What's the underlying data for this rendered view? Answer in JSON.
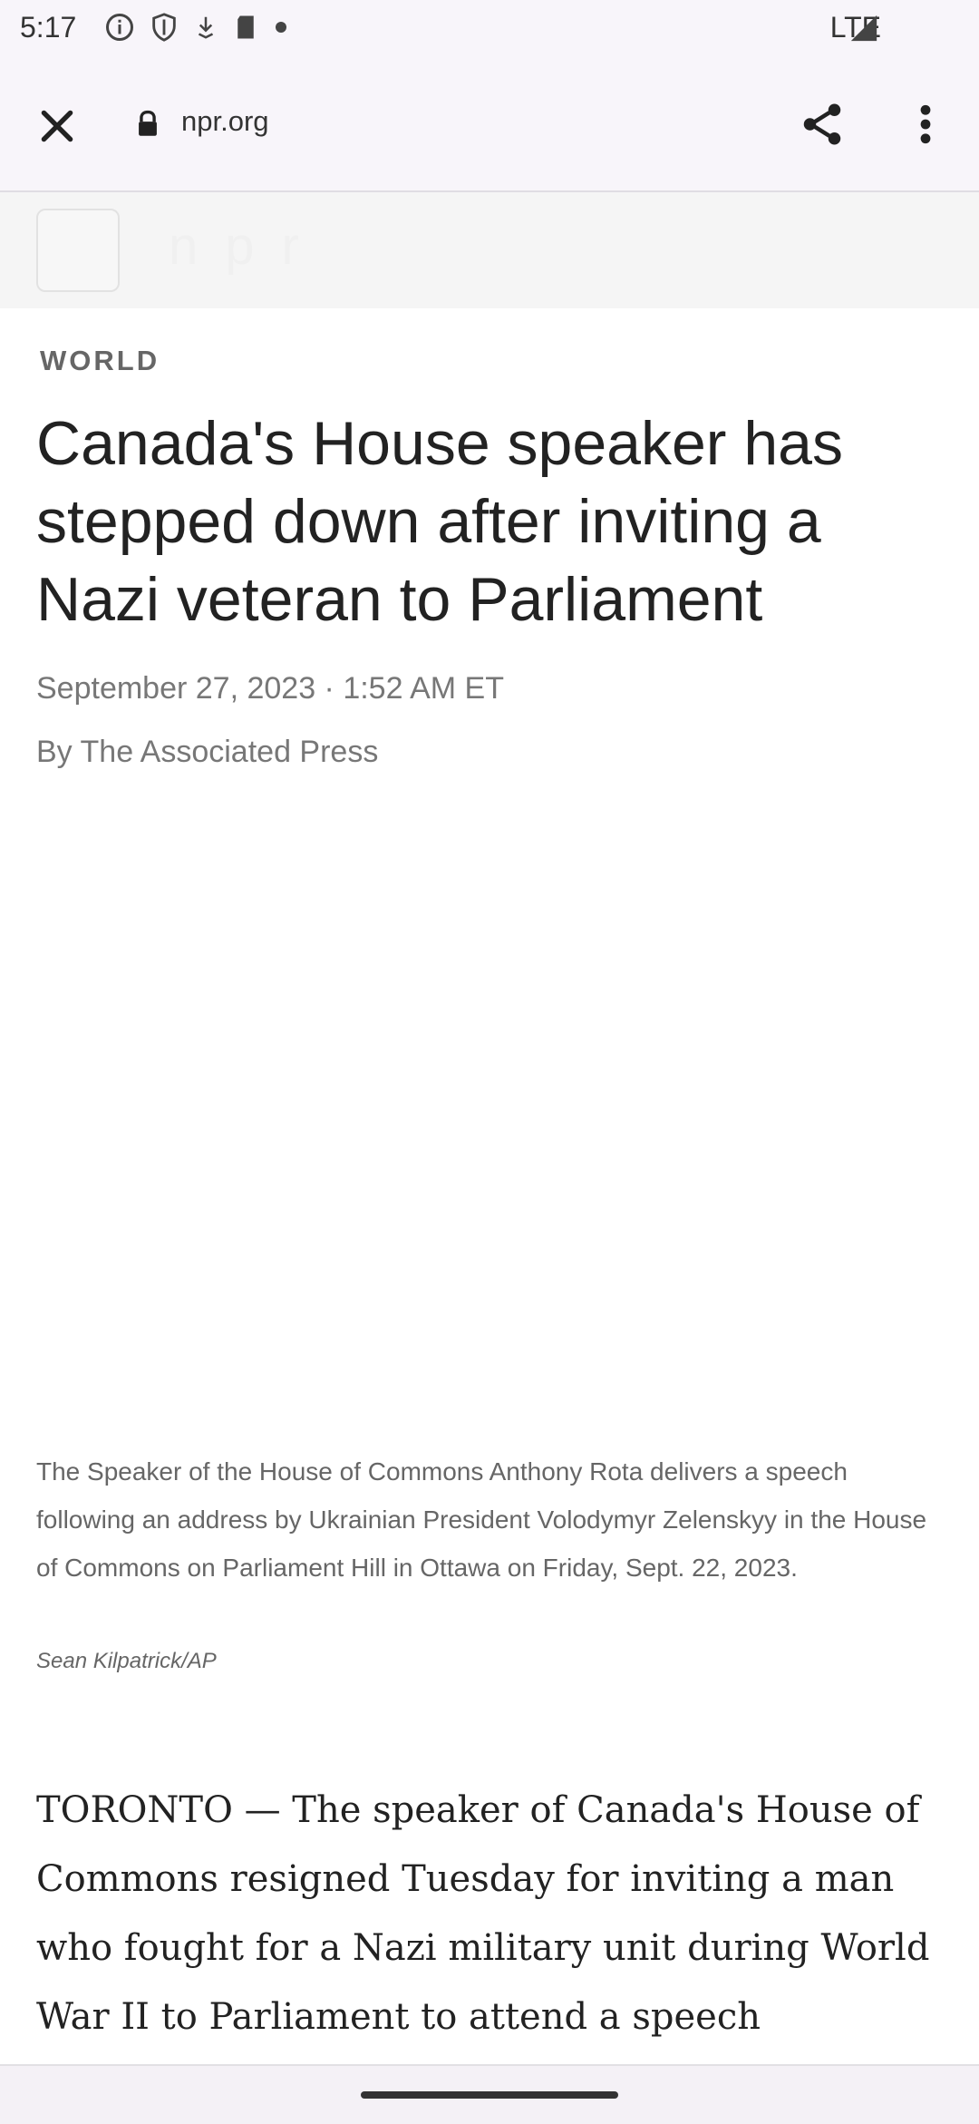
{
  "status_bar": {
    "time": "5:17",
    "network": "LTE",
    "icons": [
      "info-icon",
      "shield-icon",
      "download-icon",
      "sd-card-icon",
      "dot-icon"
    ]
  },
  "browser": {
    "url": "npr.org",
    "icons": [
      "close-icon",
      "lock-icon",
      "share-icon",
      "more-vert-icon"
    ]
  },
  "site_header": {
    "logo_text": "npr"
  },
  "article": {
    "section": "WORLD",
    "headline": "Canada's House speaker has stepped down after inviting a Nazi veteran to Parliament",
    "date": "September 27, 2023 · 1:52 AM ET",
    "byline": "By The Associated Press",
    "caption": "The Speaker of the House of Commons Anthony Rota delivers a speech following an address by Ukrainian President Volodymyr Zelenskyy in the House of Commons on Parliament Hill in Ottawa on Friday, Sept. 22, 2023.",
    "credit": "Sean Kilpatrick/AP",
    "body": "TORONTO — The speaker of Canada's House of Commons resigned Tuesday for inviting a man who fought for a Nazi military unit during World War II to Parliament to attend a speech"
  }
}
